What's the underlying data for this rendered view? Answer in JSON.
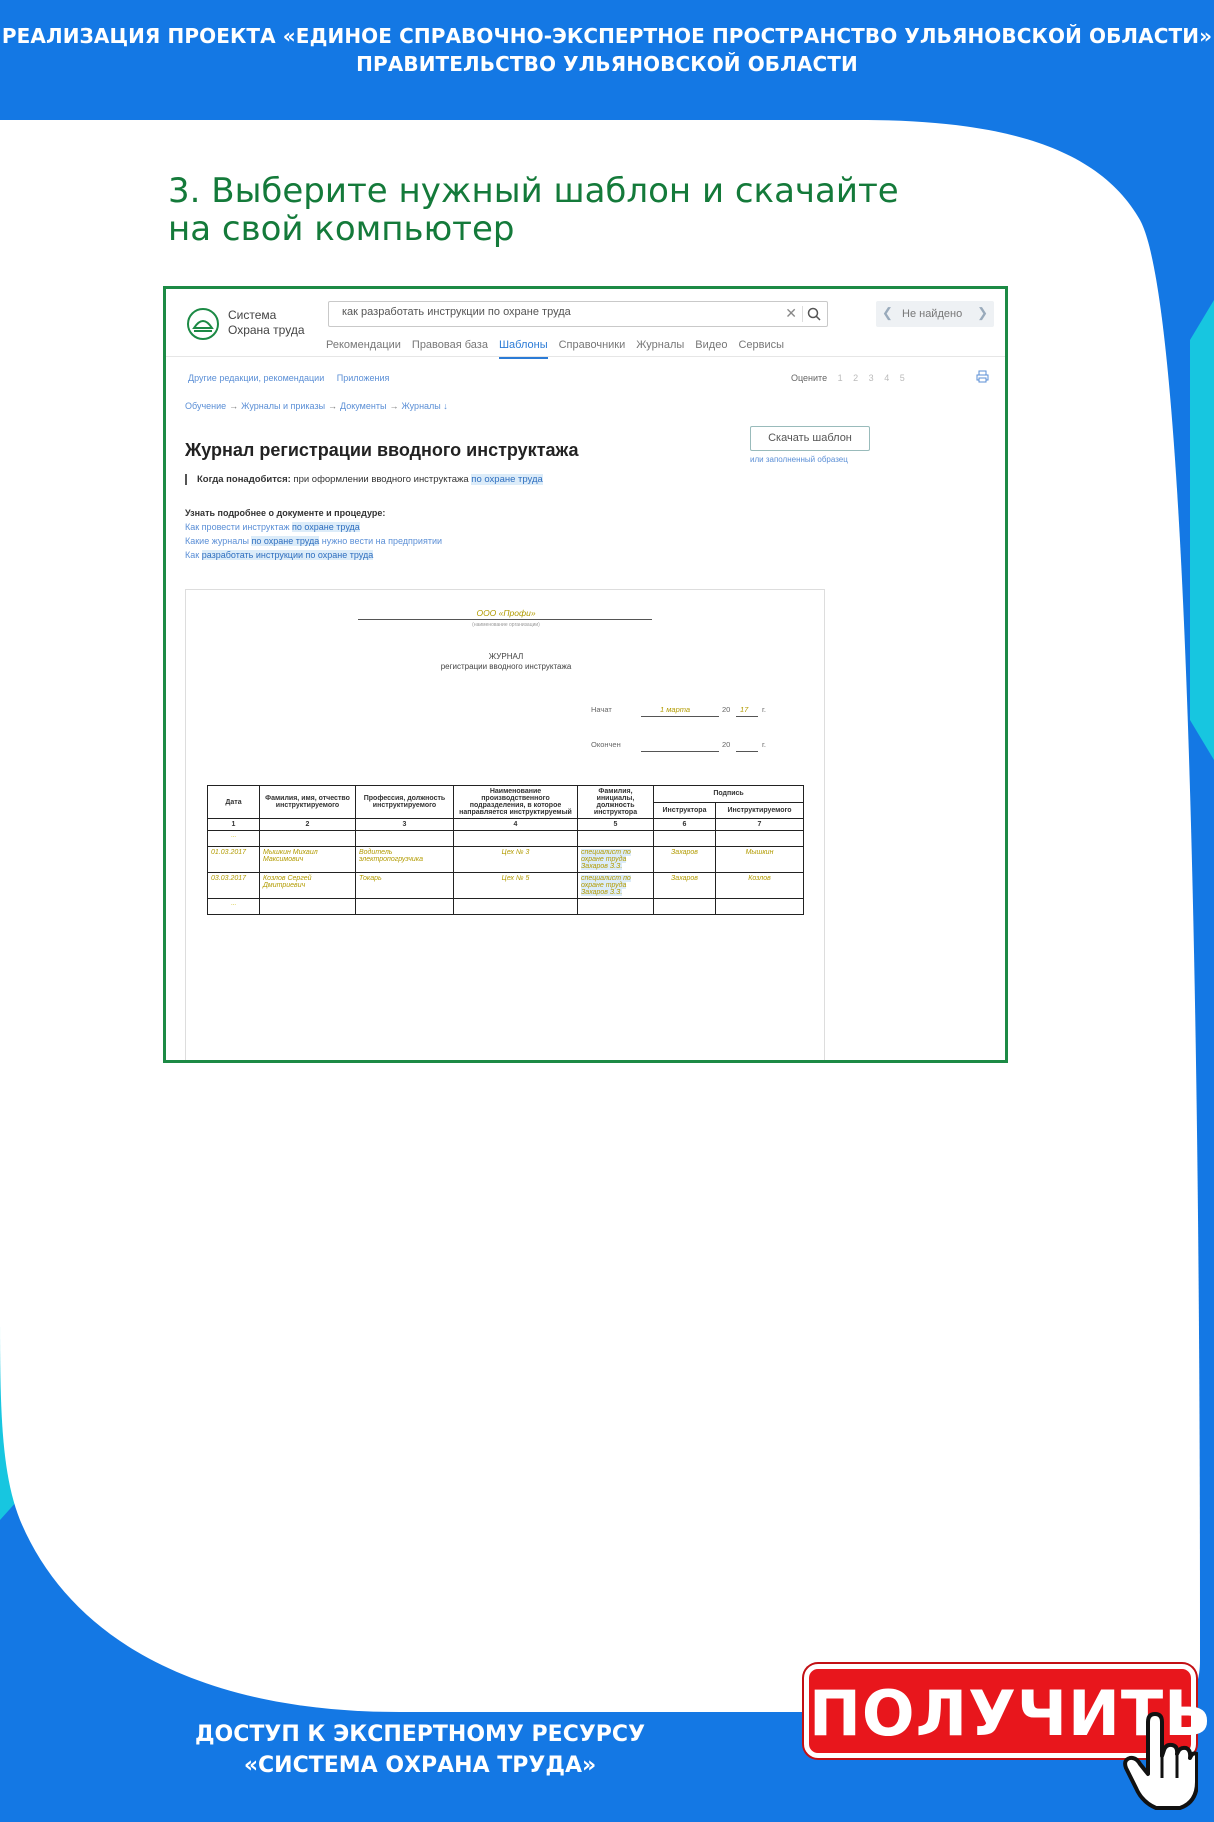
{
  "banner": {
    "line1": "РЕАЛИЗАЦИЯ ПРОЕКТА «ЕДИНОЕ СПРАВОЧНО-ЭКСПЕРТНОЕ ПРОСТРАНСТВО УЛЬЯНОВСКОЙ ОБЛАСТИ»",
    "line2": "ПРАВИТЕЛЬСТВО УЛЬЯНОВСКОЙ ОБЛАСТИ"
  },
  "slide": {
    "heading": "3. Выберите нужный шаблон и скачайте на свой компьютер"
  },
  "app": {
    "logo_line1": "Система",
    "logo_line2": "Охрана труда",
    "search_value": "как разработать инструкции по охране труда",
    "search_clear": "✕",
    "not_found_label": "Не найдено",
    "nav": [
      "Рекомендации",
      "Правовая база",
      "Шаблоны",
      "Справочники",
      "Журналы",
      "Видео",
      "Сервисы"
    ],
    "nav_active": "Шаблоны",
    "sub_nav": [
      "Другие редакции, рекомендации",
      "Приложения"
    ],
    "rate_label": "Оцените",
    "rate_marks": [
      "1",
      "2",
      "3",
      "4",
      "5"
    ],
    "breadcrumb": [
      "Обучение",
      "Журналы и приказы",
      "Документы",
      "Журналы ↓"
    ],
    "doc_title": "Журнал регистрации вводного инструктажа",
    "when_needed_label": "Когда понадобится:",
    "when_needed_text": "при оформлении вводного инструктажа",
    "when_needed_hl": "по охране труда",
    "download_button": "Скачать шаблон",
    "download_sub": "или заполненный образец",
    "learn_title": "Узнать подробнее о документе и процедуре:",
    "learn_links": [
      {
        "pre": "Как провести инструктаж ",
        "hl": "по охране труда",
        "post": ""
      },
      {
        "pre": "Какие журналы ",
        "hl": "по охране труда",
        "post": " нужно вести на предприятии"
      },
      {
        "pre": "Как ",
        "hl": "разработать инструкции по охране труда",
        "post": ""
      }
    ]
  },
  "document": {
    "org_name": "ООО «Профи»",
    "org_caption": "(наименование организации)",
    "title1": "ЖУРНАЛ",
    "title2": "регистрации вводного инструктажа",
    "started_label": "Начат",
    "started_value": "1 марта",
    "year_prefix": "20",
    "started_year": "17",
    "year_suffix": "г.",
    "finished_label": "Окончен",
    "table": {
      "headers": [
        "Дата",
        "Фамилия, имя, отчество инструктируемого",
        "Профессия, должность инструктируемого",
        "Наименование производственного подразделения, в которое направляется инструктируемый",
        "Фамилия, инициалы, должность инструктора",
        "Подпись"
      ],
      "signature_sub": [
        "Инструктора",
        "Инструктируемого"
      ],
      "numbers": [
        "1",
        "2",
        "3",
        "4",
        "5",
        "6",
        "7"
      ],
      "rows": [
        [
          "01.03.2017",
          "Мышкин Михаил Максимович",
          "Водитель электропогрузчика",
          "Цех № 3",
          "специалист по охране труда Захаров З.З.",
          "Захаров",
          "Мышкин"
        ],
        [
          "03.03.2017",
          "Козлов Сергей Дмитриевич",
          "Токарь",
          "Цех № 5",
          "специалист по охране труда Захаров З.З.",
          "Захаров",
          "Козлов"
        ]
      ],
      "ellipsis": "..."
    }
  },
  "footer": {
    "line1": "ДОСТУП К ЭКСПЕРТНОМУ РЕСУРСУ",
    "line2": "«СИСТЕМА ОХРАНА ТРУДА»"
  },
  "cta": {
    "label": "ПОЛУЧИТЬ"
  },
  "colors": {
    "brand_blue": "#1478e4",
    "cyan_accent": "#17c6e0",
    "heading_green": "#147a3a",
    "frame_green": "#1c8a45",
    "cta_red": "#e8161c"
  }
}
